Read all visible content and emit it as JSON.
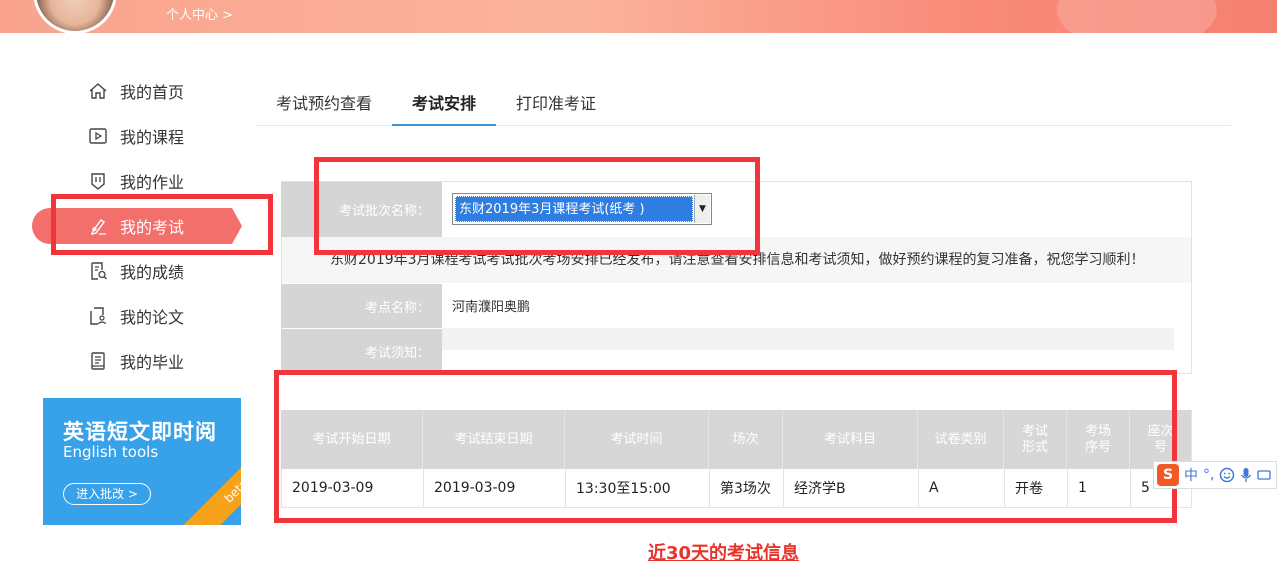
{
  "header": {
    "profile_link": "个人中心 >"
  },
  "sidebar": {
    "items": [
      {
        "label": "我的首页",
        "icon": "home-icon"
      },
      {
        "label": "我的课程",
        "icon": "play-course-icon"
      },
      {
        "label": "我的作业",
        "icon": "homework-icon"
      },
      {
        "label": "我的考试",
        "icon": "pen-exam-icon",
        "active": true
      },
      {
        "label": "我的成绩",
        "icon": "report-search-icon"
      },
      {
        "label": "我的论文",
        "icon": "paper-user-icon"
      },
      {
        "label": "我的毕业",
        "icon": "certificate-icon"
      }
    ]
  },
  "ad": {
    "title": "英语短文即时阅",
    "subtitle": "English tools",
    "button": "进入批改 >",
    "badge": "beta"
  },
  "tabs": [
    {
      "label": "考试预约查看"
    },
    {
      "label": "考试安排",
      "active": true
    },
    {
      "label": "打印准考证"
    }
  ],
  "form": {
    "batch_label": "考试批次名称：",
    "batch_value": "东财2019年3月课程考试(纸考 )",
    "notice": "东财2019年3月课程考试考试批次考场安排已经发布，请注意查看安排信息和考试须知，做好预约课程的复习准备，祝您学习顺利！",
    "site_label": "考点名称：",
    "site_value": "河南濮阳奥鹏",
    "notes_label": "考试须知：",
    "notes_value": ""
  },
  "table": {
    "headers": [
      "考试开始日期",
      "考试结束日期",
      "考试时间",
      "场次",
      "考试科目",
      "试卷类别",
      "考试形式",
      "考场序号",
      "座次号"
    ],
    "rows": [
      [
        "2019-03-09",
        "2019-03-09",
        "13:30至15:00",
        "第3场次",
        "经济学B",
        "A",
        "开卷",
        "1",
        "5"
      ]
    ]
  },
  "caption": "近30天的考试信息",
  "ime": {
    "logo": "S",
    "items": [
      "中",
      "°,"
    ]
  },
  "colors": {
    "accent_red": "#f36f6b",
    "annotation_red": "#f2353a",
    "tab_underline": "#3d95d8",
    "select_highlight": "#2f7de0"
  }
}
